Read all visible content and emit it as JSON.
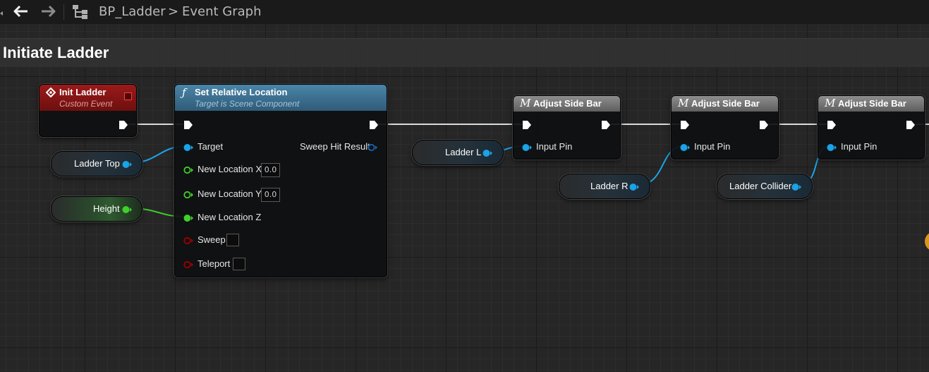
{
  "toolbar": {
    "breadcrumb_blueprint": "BP_Ladder",
    "breadcrumb_separator": ">",
    "breadcrumb_graph": "Event Graph",
    "icons": [
      "back-arrow-icon",
      "forward-arrow-icon",
      "graph-hierarchy-icon"
    ]
  },
  "comment": {
    "title": "Initiate Ladder"
  },
  "nodes": {
    "init_ladder": {
      "title": "Init Ladder",
      "subtitle": "Custom Event"
    },
    "set_relative_location": {
      "title": "Set Relative Location",
      "subtitle": "Target is Scene Component",
      "pins": {
        "target": "Target",
        "sweep_hit_result": "Sweep Hit Result",
        "new_location_x": "New Location X",
        "new_location_x_value": "0.0",
        "new_location_y": "New Location Y",
        "new_location_y_value": "0.0",
        "new_location_z": "New Location Z",
        "sweep": "Sweep",
        "teleport": "Teleport"
      }
    },
    "adjust_side_bar_1": {
      "title": "Adjust Side Bar",
      "input_pin": "Input Pin"
    },
    "adjust_side_bar_2": {
      "title": "Adjust Side Bar",
      "input_pin": "Input Pin"
    },
    "adjust_side_bar_3": {
      "title": "Adjust Side Bar",
      "input_pin": "Input Pin"
    }
  },
  "variables": {
    "ladder_top": "Ladder Top",
    "height": "Height",
    "ladder_l": "Ladder L",
    "ladder_r": "Ladder R",
    "ladder_collider": "Ladder Collider"
  },
  "colors": {
    "event_header": "#8a1414",
    "function_header": "#3c6f8f",
    "macro_header": "#7a7a7a",
    "object_pin": "#1aa3e8",
    "float_pin": "#3fd12a",
    "bool_pin": "#a00000",
    "struct_pin": "#1864b0",
    "exec_wire": "#e6e6e6"
  }
}
